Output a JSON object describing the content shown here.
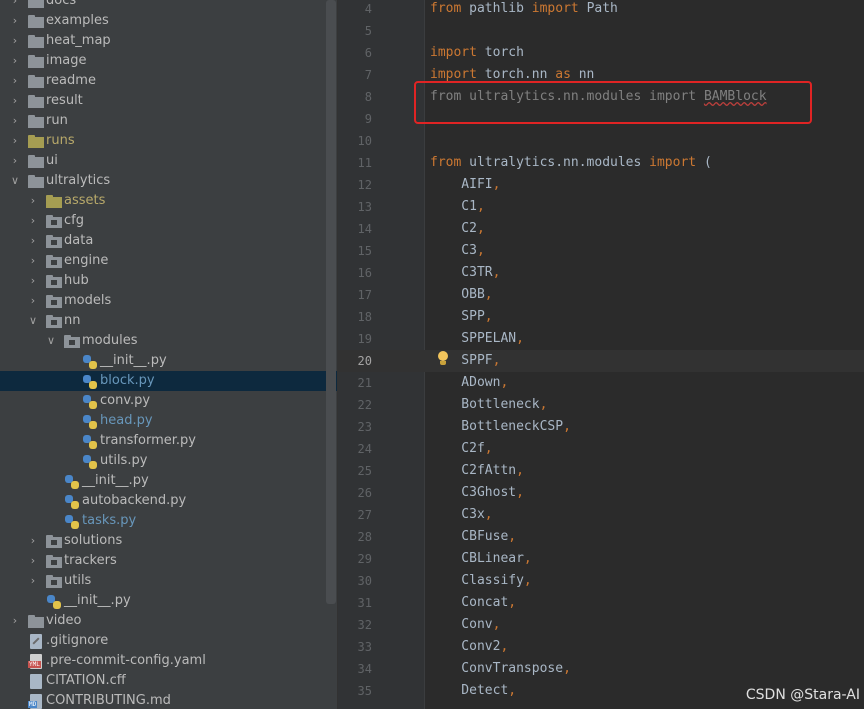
{
  "project_tree": [
    {
      "id": "docs",
      "label": "docs",
      "kind": "folder",
      "depth": 0,
      "expanded": false
    },
    {
      "id": "examples",
      "label": "examples",
      "kind": "folder",
      "depth": 0,
      "expanded": false
    },
    {
      "id": "heat_map",
      "label": "heat_map",
      "kind": "folder",
      "depth": 0,
      "expanded": false
    },
    {
      "id": "image",
      "label": "image",
      "kind": "folder",
      "depth": 0,
      "expanded": false
    },
    {
      "id": "readme",
      "label": "readme",
      "kind": "folder",
      "depth": 0,
      "expanded": false
    },
    {
      "id": "result",
      "label": "result",
      "kind": "folder",
      "depth": 0,
      "expanded": false
    },
    {
      "id": "run",
      "label": "run",
      "kind": "folder",
      "depth": 0,
      "expanded": false
    },
    {
      "id": "runs",
      "label": "runs",
      "kind": "folder-excluded",
      "depth": 0,
      "expanded": false
    },
    {
      "id": "ui",
      "label": "ui",
      "kind": "folder",
      "depth": 0,
      "expanded": false
    },
    {
      "id": "ultralytics",
      "label": "ultralytics",
      "kind": "folder",
      "depth": 0,
      "expanded": true
    },
    {
      "id": "assets",
      "label": "assets",
      "kind": "folder-excluded",
      "depth": 1,
      "expanded": false
    },
    {
      "id": "cfg",
      "label": "cfg",
      "kind": "package",
      "depth": 1,
      "expanded": false
    },
    {
      "id": "data",
      "label": "data",
      "kind": "package",
      "depth": 1,
      "expanded": false
    },
    {
      "id": "engine",
      "label": "engine",
      "kind": "package",
      "depth": 1,
      "expanded": false
    },
    {
      "id": "hub",
      "label": "hub",
      "kind": "package",
      "depth": 1,
      "expanded": false
    },
    {
      "id": "models",
      "label": "models",
      "kind": "package",
      "depth": 1,
      "expanded": false
    },
    {
      "id": "nn",
      "label": "nn",
      "kind": "package",
      "depth": 1,
      "expanded": true
    },
    {
      "id": "modules",
      "label": "modules",
      "kind": "package",
      "depth": 2,
      "expanded": true
    },
    {
      "id": "modules-init",
      "label": "__init__.py",
      "kind": "python",
      "depth": 3
    },
    {
      "id": "block",
      "label": "block.py",
      "kind": "python",
      "depth": 3,
      "selected": true,
      "modified": true
    },
    {
      "id": "conv",
      "label": "conv.py",
      "kind": "python",
      "depth": 3
    },
    {
      "id": "head",
      "label": "head.py",
      "kind": "python",
      "depth": 3,
      "modified": true
    },
    {
      "id": "transformer",
      "label": "transformer.py",
      "kind": "python",
      "depth": 3
    },
    {
      "id": "utils-py",
      "label": "utils.py",
      "kind": "python",
      "depth": 3
    },
    {
      "id": "nn-init",
      "label": "__init__.py",
      "kind": "python",
      "depth": 2
    },
    {
      "id": "autobackend",
      "label": "autobackend.py",
      "kind": "python",
      "depth": 2
    },
    {
      "id": "tasks",
      "label": "tasks.py",
      "kind": "python",
      "depth": 2,
      "modified": true
    },
    {
      "id": "solutions",
      "label": "solutions",
      "kind": "package",
      "depth": 1,
      "expanded": false
    },
    {
      "id": "trackers",
      "label": "trackers",
      "kind": "package",
      "depth": 1,
      "expanded": false
    },
    {
      "id": "utils",
      "label": "utils",
      "kind": "package",
      "depth": 1,
      "expanded": false
    },
    {
      "id": "ultralytics-init",
      "label": "__init__.py",
      "kind": "python",
      "depth": 1
    },
    {
      "id": "video",
      "label": "video",
      "kind": "folder",
      "depth": 0,
      "expanded": false
    },
    {
      "id": "gitignore",
      "label": ".gitignore",
      "kind": "gitignore",
      "depth": 0
    },
    {
      "id": "precommit",
      "label": ".pre-commit-config.yaml",
      "kind": "yaml",
      "depth": 0
    },
    {
      "id": "citation",
      "label": "CITATION.cff",
      "kind": "file",
      "depth": 0
    },
    {
      "id": "contributing",
      "label": "CONTRIBUTING.md",
      "kind": "markdown",
      "depth": 0
    }
  ],
  "editor": {
    "current_line": 20,
    "lines": [
      {
        "n": "4",
        "tokens": [
          {
            "t": "from ",
            "c": "kw"
          },
          {
            "t": "pathlib "
          },
          {
            "t": "import ",
            "c": "kw"
          },
          {
            "t": "Path"
          }
        ]
      },
      {
        "n": "5",
        "tokens": []
      },
      {
        "n": "6",
        "tokens": [
          {
            "t": "import ",
            "c": "kw"
          },
          {
            "t": "torch"
          }
        ]
      },
      {
        "n": "7",
        "tokens": [
          {
            "t": "import ",
            "c": "kw"
          },
          {
            "t": "torch.nn "
          },
          {
            "t": "as ",
            "c": "kw"
          },
          {
            "t": "nn"
          }
        ]
      },
      {
        "n": "8",
        "tokens": [
          {
            "t": "from ultralytics.nn.modules import ",
            "c": "dim"
          },
          {
            "t": "BAMBlock",
            "c": "squig"
          }
        ]
      },
      {
        "n": "9",
        "tokens": []
      },
      {
        "n": "10",
        "tokens": []
      },
      {
        "n": "11",
        "tokens": [
          {
            "t": "from ",
            "c": "kw"
          },
          {
            "t": "ultralytics.nn.modules "
          },
          {
            "t": "import ",
            "c": "kw"
          },
          {
            "t": "("
          }
        ]
      },
      {
        "n": "12",
        "tokens": [
          {
            "t": "    AIFI"
          },
          {
            "t": ",",
            "c": "kw"
          }
        ]
      },
      {
        "n": "13",
        "tokens": [
          {
            "t": "    C1"
          },
          {
            "t": ",",
            "c": "kw"
          }
        ]
      },
      {
        "n": "14",
        "tokens": [
          {
            "t": "    C2"
          },
          {
            "t": ",",
            "c": "kw"
          }
        ]
      },
      {
        "n": "15",
        "tokens": [
          {
            "t": "    C3"
          },
          {
            "t": ",",
            "c": "kw"
          }
        ]
      },
      {
        "n": "16",
        "tokens": [
          {
            "t": "    C3TR"
          },
          {
            "t": ",",
            "c": "kw"
          }
        ]
      },
      {
        "n": "17",
        "tokens": [
          {
            "t": "    OBB"
          },
          {
            "t": ",",
            "c": "kw"
          }
        ]
      },
      {
        "n": "18",
        "tokens": [
          {
            "t": "    SPP"
          },
          {
            "t": ",",
            "c": "kw"
          }
        ]
      },
      {
        "n": "19",
        "tokens": [
          {
            "t": "    SPPELAN"
          },
          {
            "t": ",",
            "c": "kw"
          }
        ]
      },
      {
        "n": "20",
        "tokens": [
          {
            "t": "    SPPF"
          },
          {
            "t": ",",
            "c": "kw"
          }
        ]
      },
      {
        "n": "21",
        "tokens": [
          {
            "t": "    ADown"
          },
          {
            "t": ",",
            "c": "kw"
          }
        ]
      },
      {
        "n": "22",
        "tokens": [
          {
            "t": "    Bottleneck"
          },
          {
            "t": ",",
            "c": "kw"
          }
        ]
      },
      {
        "n": "23",
        "tokens": [
          {
            "t": "    BottleneckCSP"
          },
          {
            "t": ",",
            "c": "kw"
          }
        ]
      },
      {
        "n": "24",
        "tokens": [
          {
            "t": "    C2f"
          },
          {
            "t": ",",
            "c": "kw"
          }
        ]
      },
      {
        "n": "25",
        "tokens": [
          {
            "t": "    C2fAttn"
          },
          {
            "t": ",",
            "c": "kw"
          }
        ]
      },
      {
        "n": "26",
        "tokens": [
          {
            "t": "    C3Ghost"
          },
          {
            "t": ",",
            "c": "kw"
          }
        ]
      },
      {
        "n": "27",
        "tokens": [
          {
            "t": "    C3x"
          },
          {
            "t": ",",
            "c": "kw"
          }
        ]
      },
      {
        "n": "28",
        "tokens": [
          {
            "t": "    CBFuse"
          },
          {
            "t": ",",
            "c": "kw"
          }
        ]
      },
      {
        "n": "29",
        "tokens": [
          {
            "t": "    CBLinear"
          },
          {
            "t": ",",
            "c": "kw"
          }
        ]
      },
      {
        "n": "30",
        "tokens": [
          {
            "t": "    Classify"
          },
          {
            "t": ",",
            "c": "kw"
          }
        ]
      },
      {
        "n": "31",
        "tokens": [
          {
            "t": "    Concat"
          },
          {
            "t": ",",
            "c": "kw"
          }
        ]
      },
      {
        "n": "32",
        "tokens": [
          {
            "t": "    Conv"
          },
          {
            "t": ",",
            "c": "kw"
          }
        ]
      },
      {
        "n": "33",
        "tokens": [
          {
            "t": "    Conv2"
          },
          {
            "t": ",",
            "c": "kw"
          }
        ]
      },
      {
        "n": "34",
        "tokens": [
          {
            "t": "    ConvTranspose"
          },
          {
            "t": ",",
            "c": "kw"
          }
        ]
      },
      {
        "n": "35",
        "tokens": [
          {
            "t": "    Detect"
          },
          {
            "t": ",",
            "c": "kw"
          }
        ]
      }
    ]
  },
  "watermark": "CSDN @Stara-AI",
  "colors": {
    "keyword": "#cc7832",
    "identifier": "#a9b7c6",
    "error_underline": "#bc3f3c",
    "highlight_box": "#e02424",
    "selection": "#0d293e"
  }
}
